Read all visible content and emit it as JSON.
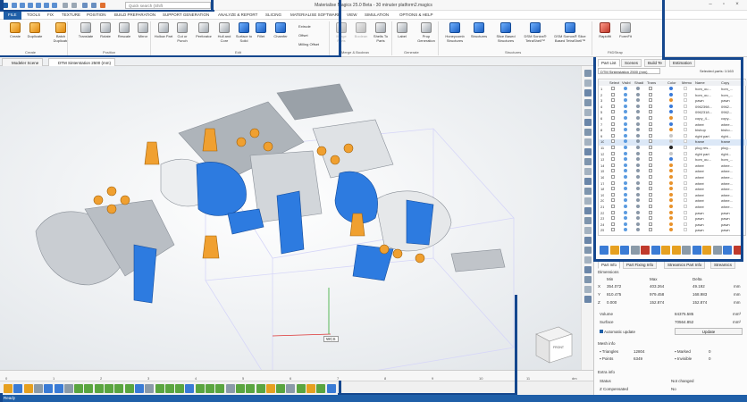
{
  "app": {
    "title": "Materialise Magics 25.0 Beta - 30 minuter platform2.magics",
    "search_placeholder": "Quick search (Shift",
    "status": "Ready"
  },
  "menu": [
    "FILE",
    "TOOLS",
    "FIX",
    "TEXTURE",
    "POSITION",
    "BUILD PREPARATION",
    "SUPPORT GENERATION",
    "ANALYZE & REPORT",
    "SLICING",
    "MATERIALISE SOFTWARE",
    "VIEW",
    "SIMULATION",
    "OPTIONS & HELP"
  ],
  "ribbon": {
    "buttons": [
      {
        "label": "Create",
        "icon": "create-icon",
        "style": "o"
      },
      {
        "label": "Duplicate",
        "icon": "duplicate-icon",
        "style": "o"
      },
      {
        "label": "Batch Duplicate",
        "icon": "batch-duplicate-icon",
        "style": "o"
      },
      {
        "label": "Translate",
        "icon": "translate-icon",
        "style": "w"
      },
      {
        "label": "Rotate",
        "icon": "rotate-icon",
        "style": "w"
      },
      {
        "label": "Rescale",
        "icon": "rescale-icon",
        "style": "w"
      },
      {
        "label": "Mirror",
        "icon": "mirror-icon",
        "style": "w"
      },
      {
        "label": "Hollow Part",
        "icon": "hollow-part-icon",
        "style": "w"
      },
      {
        "label": "Cut or Punch",
        "icon": "cut-punch-icon",
        "style": "w"
      },
      {
        "label": "Perforator",
        "icon": "perforator-icon",
        "style": "w"
      },
      {
        "label": "Hull and Core",
        "icon": "hull-core-icon",
        "style": "w"
      },
      {
        "label": "Surface to Solid",
        "icon": "surface-solid-icon",
        "style": "b"
      },
      {
        "label": "Fillet",
        "icon": "fillet-icon",
        "style": "b"
      },
      {
        "label": "Chamfer",
        "icon": "chamfer-icon",
        "style": "b"
      },
      {
        "label": "Merge Parts",
        "icon": "merge-parts-icon",
        "style": "g",
        "disabled": true
      },
      {
        "label": "Boolean",
        "icon": "boolean-icon",
        "style": "g",
        "disabled": true
      },
      {
        "label": "Shells To Parts",
        "icon": "shells-parts-icon",
        "style": "w"
      },
      {
        "label": "Label",
        "icon": "label-icon",
        "style": "w"
      },
      {
        "label": "Prop Generation",
        "icon": "prop-generation-icon",
        "style": "w"
      },
      {
        "label": "Honeycomb Structures",
        "icon": "honeycomb-icon",
        "style": "b"
      },
      {
        "label": "Structures",
        "icon": "structures-icon",
        "style": "b"
      },
      {
        "label": "Slice Based Structures",
        "icon": "slice-structures-icon",
        "style": "b"
      },
      {
        "label": "DSM Sonics® TetraShell™",
        "icon": "tetrashell-icon",
        "style": "b"
      },
      {
        "label": "DSM Somos® Slice Based TetraShell™",
        "icon": "slice-tetrashell-icon",
        "style": "b"
      },
      {
        "label": "Rapidfit",
        "icon": "rapidfit-icon",
        "style": "r"
      },
      {
        "label": "FormFit",
        "icon": "formfit-icon",
        "style": "w"
      }
    ],
    "small_buttons": [
      "Extrude",
      "Offset",
      "Milling Offset"
    ],
    "groups": [
      "Create",
      "Position",
      "Edit",
      "Merge & Boolean",
      "Generate",
      "Structures",
      "FitDStrap"
    ]
  },
  "scene_tabs": [
    "Modeler Scene",
    "DTM Sinterstation 2500 (mm)"
  ],
  "viewport": {
    "wcs_label": "WCS",
    "cube_label": "FRONT",
    "ruler_unit": "dm",
    "ruler_ticks": [
      "0",
      "1",
      "2",
      "3",
      "4",
      "5",
      "6",
      "7",
      "8",
      "9",
      "10",
      "11"
    ]
  },
  "right_panel": {
    "tabs": [
      "Part List",
      "Scenes",
      "Build Te"
    ],
    "estimation_tab": "Estimation",
    "machine": "DTM Sinterstation 2500 (mm)",
    "selected_parts": "Selected parts: 1/163",
    "left_cols": [
      "Select",
      "Visibl",
      "Shadi",
      "Trans"
    ],
    "right_cols": [
      "Color",
      "Memo",
      "Name",
      "Copy"
    ],
    "rows": [
      {
        "n": "1",
        "name": "hom_ou...",
        "copy": "hom_...",
        "color": "#3b7ad8"
      },
      {
        "n": "2",
        "name": "hom_ou...",
        "copy": "hom_...",
        "color": "#3b7ad8"
      },
      {
        "n": "3",
        "name": "pawn",
        "copy": "pawn",
        "color": "#e8922b"
      },
      {
        "n": "4",
        "name": "0962398...",
        "copy": "0962...",
        "color": "#3b7ad8"
      },
      {
        "n": "5",
        "name": "0962318...",
        "copy": "0962...",
        "color": "#3b7ad8"
      },
      {
        "n": "6",
        "name": "copy_4...",
        "copy": "copy...",
        "color": "#e8922b"
      },
      {
        "n": "7",
        "name": "wheel",
        "copy": "whee...",
        "color": "#3b7ad8"
      },
      {
        "n": "8",
        "name": "bishop",
        "copy": "bisho...",
        "color": "#e8922b"
      },
      {
        "n": "9",
        "name": "right part",
        "copy": "right...",
        "color": "#c7c7c7"
      },
      {
        "n": "10",
        "name": "frame",
        "copy": "frame",
        "color": "#c7c7c7"
      },
      {
        "n": "11",
        "name": "plug res...",
        "copy": "plug...",
        "color": "#222222"
      },
      {
        "n": "12",
        "name": "right part",
        "copy": "right...",
        "color": "#c7c7c7"
      },
      {
        "n": "13",
        "name": "hom_ou...",
        "copy": "hom_...",
        "color": "#3b7ad8"
      },
      {
        "n": "14",
        "name": "wheel",
        "copy": "whee...",
        "color": "#e8922b"
      },
      {
        "n": "15",
        "name": "wheel",
        "copy": "whee...",
        "color": "#e8922b"
      },
      {
        "n": "16",
        "name": "wheel",
        "copy": "whee...",
        "color": "#e8922b"
      },
      {
        "n": "17",
        "name": "wheel",
        "copy": "whee...",
        "color": "#e8922b"
      },
      {
        "n": "18",
        "name": "wheel",
        "copy": "whee...",
        "color": "#e8922b"
      },
      {
        "n": "19",
        "name": "wheel",
        "copy": "whee...",
        "color": "#e8922b"
      },
      {
        "n": "20",
        "name": "wheel",
        "copy": "whee...",
        "color": "#e8922b"
      },
      {
        "n": "21",
        "name": "wheel",
        "copy": "whee...",
        "color": "#e8922b"
      },
      {
        "n": "22",
        "name": "pawn",
        "copy": "pawn",
        "color": "#e8922b"
      },
      {
        "n": "23",
        "name": "pawn",
        "copy": "pawn",
        "color": "#e8922b"
      },
      {
        "n": "24",
        "name": "pawn",
        "copy": "pawn",
        "color": "#e8922b"
      },
      {
        "n": "25",
        "name": "pawn",
        "copy": "pawn",
        "color": "#e8922b"
      }
    ],
    "info_tabs": [
      "Part Info",
      "Part Fixing Info",
      "Streamics Part Info",
      "Streamics"
    ],
    "dimensions": {
      "section": "Dimensions",
      "headers": [
        "Min",
        "Max",
        "Delta"
      ],
      "rows": [
        {
          "axis": "X",
          "min": "354.072",
          "max": "403.264",
          "delta": "49.192",
          "unit": "mm"
        },
        {
          "axis": "Y",
          "min": "810.475",
          "max": "979.458",
          "delta": "168.983",
          "unit": "mm"
        },
        {
          "axis": "Z",
          "min": "0.000",
          "max": "152.874",
          "delta": "152.874",
          "unit": "mm"
        }
      ],
      "volume_label": "Volume",
      "volume": "84375.585",
      "volume_unit": "mm³",
      "surface_label": "Surface",
      "surface": "70564.852",
      "surface_unit": "mm²",
      "auto_update": "Automatic update",
      "update_btn": "Update"
    },
    "mesh": {
      "section": "Mesh info",
      "triangles_label": "Triangles",
      "triangles": "12804",
      "marked_label": "Marked",
      "marked": "0",
      "points_label": "Points",
      "points": "6349",
      "invisible_label": "Invisible",
      "invisible": "0"
    },
    "extra": {
      "section": "Extra info",
      "status_label": "Status",
      "status": "Not changed",
      "zcomp_label": "Z Compensated",
      "zcomp": "No"
    }
  }
}
